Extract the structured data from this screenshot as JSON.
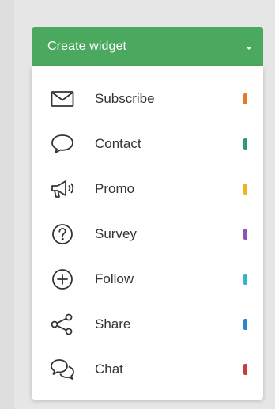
{
  "create_button": {
    "label": "Create widget",
    "color": "#4aa85f"
  },
  "menu": {
    "items": [
      {
        "label": "Subscribe",
        "icon": "envelope-icon",
        "color": "#e8782a"
      },
      {
        "label": "Contact",
        "icon": "speech-bubble-icon",
        "color": "#2a9a80"
      },
      {
        "label": "Promo",
        "icon": "megaphone-icon",
        "color": "#f2b41d"
      },
      {
        "label": "Survey",
        "icon": "question-circle-icon",
        "color": "#8a56b8"
      },
      {
        "label": "Follow",
        "icon": "plus-circle-icon",
        "color": "#32b3d0"
      },
      {
        "label": "Share",
        "icon": "share-icon",
        "color": "#2d86cc"
      },
      {
        "label": "Chat",
        "icon": "chat-bubbles-icon",
        "color": "#cf3a3a"
      }
    ]
  }
}
